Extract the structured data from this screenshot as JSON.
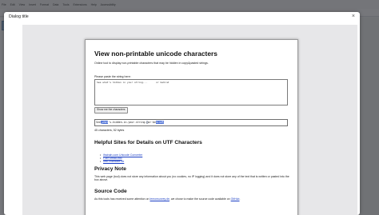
{
  "background_app": {
    "menu_items": [
      "File",
      "Edit",
      "View",
      "Insert",
      "Format",
      "Data",
      "Tools",
      "Extensions",
      "Help",
      "Accessibility"
    ]
  },
  "dialog": {
    "title": "Dialog title",
    "close_glyph": "×"
  },
  "page": {
    "heading": "View non-printable unicode characters",
    "intro": "Online tool to display non-printable characters that may be hidden in copy&pasted strings.",
    "paste_label": "Please paste the string here:",
    "textarea_value": "See what's hidden in your string...      or behind",
    "button_label": "Show me the characters",
    "output": {
      "before": "See",
      "mark1": "␣what",
      "mid": "'s-hidden-in-your-string.",
      "mark2": "□",
      "mid2": "or·be",
      "mark3": "​hind",
      "end": "¶"
    },
    "count_text": "45 characters, 52 bytes",
    "helpful_heading": "Helpful Sites for Details on UTF Characters",
    "links": [
      "ifrainah.com Unicode Converter",
      "FileFormat.Info",
      "utf8-chartable.de"
    ],
    "privacy_heading": "Privacy Note",
    "privacy_text": "This web page (tool) does not store any information about you (no cookies, no IP logging) and it does not store any of the text that is written or pasted into the box above.",
    "source_heading": "Source Code",
    "source_prefix": "As this tools has received some attention on ",
    "source_link1": "lemonsurvey.de",
    "source_middle": ", we chose to make the source code available on ",
    "source_link2": "GitHub",
    "source_suffix": "."
  }
}
